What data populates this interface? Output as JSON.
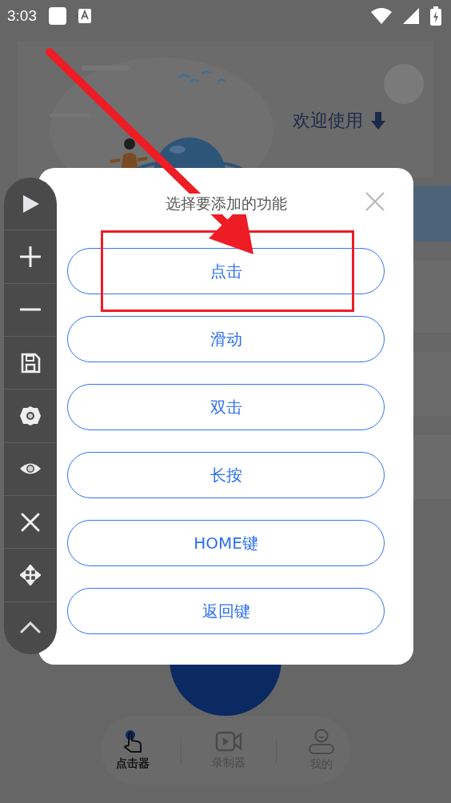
{
  "status_bar": {
    "time": "3:03"
  },
  "banner": {
    "heading": "欢迎使用"
  },
  "bottom_nav": {
    "items": [
      {
        "kind": "clicker",
        "label": "点击器",
        "selected": true
      },
      {
        "kind": "recorder",
        "label": "录制器",
        "selected": false
      },
      {
        "kind": "profile",
        "label": "我的",
        "selected": false
      }
    ]
  },
  "dialog": {
    "title": "选择要添加的功能",
    "options": [
      "点击",
      "滑动",
      "双击",
      "长按",
      "HOME键",
      "返回键"
    ]
  }
}
